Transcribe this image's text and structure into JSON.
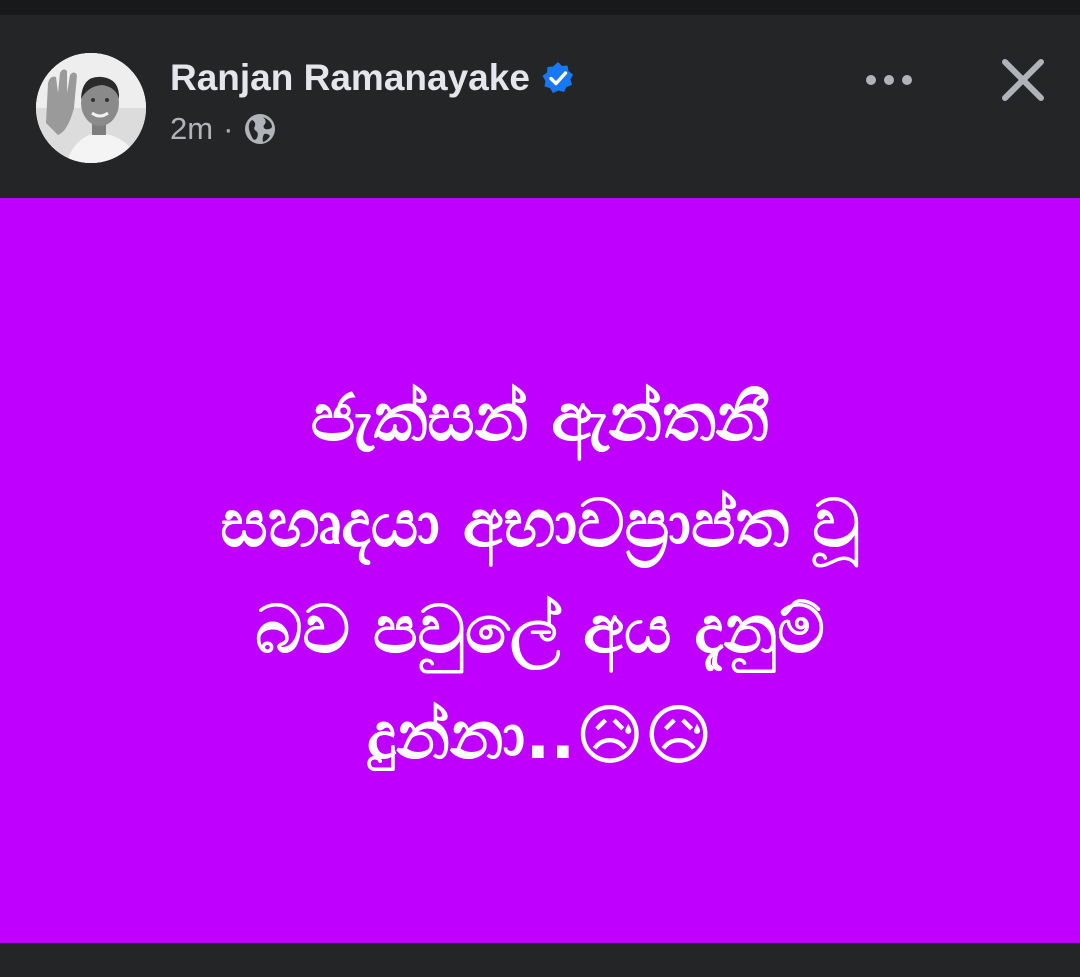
{
  "post": {
    "author": "Ranjan Ramanayake",
    "verified": true,
    "time": "2m",
    "separator": "·",
    "audience_icon": "globe-icon",
    "text": "ජැක්සන් ඇන්තනී\nසහෘදයා අභාවප්‍රාප්ත වූ\nබව පවුලේ අය දැනුම්\nදුන්නා..😥😥",
    "background_color": "#c000ff"
  },
  "header": {
    "more_icon": "more-options-icon",
    "close_icon": "close-icon"
  },
  "colors": {
    "header_bg": "#242526",
    "name_text": "#e4e6eb",
    "meta_text": "#b0b3b8",
    "verified_badge": "#1877f2"
  }
}
